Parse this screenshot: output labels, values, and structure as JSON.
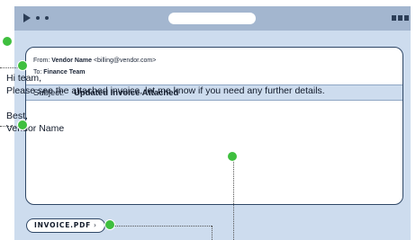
{
  "email": {
    "from_label": "From:",
    "from_name": "Vendor Name",
    "from_address": "<billing@vendor.com>",
    "to_label": "To:",
    "to_name": "Finance Team",
    "subject_label": "Subject:",
    "subject_value": "Updated Invoice Attached",
    "body": {
      "greeting": "Hi team,",
      "message": "Please see the attached invoice, let me know if you need any further details.",
      "signoff": "Best,",
      "signature": "Vendor Name"
    }
  },
  "attachment": {
    "filename": "INVOICE.PDF",
    "chevron": "›"
  },
  "icons": {
    "play": "play-icon",
    "dots": "window-dots-icon",
    "menu": "menu-icon",
    "marker": "annotation-marker-icon"
  },
  "colors": {
    "window_background": "#cddcee",
    "titlebar": "#a3b6cf",
    "border": "#2f4766",
    "marker": "#3fbf3f"
  }
}
